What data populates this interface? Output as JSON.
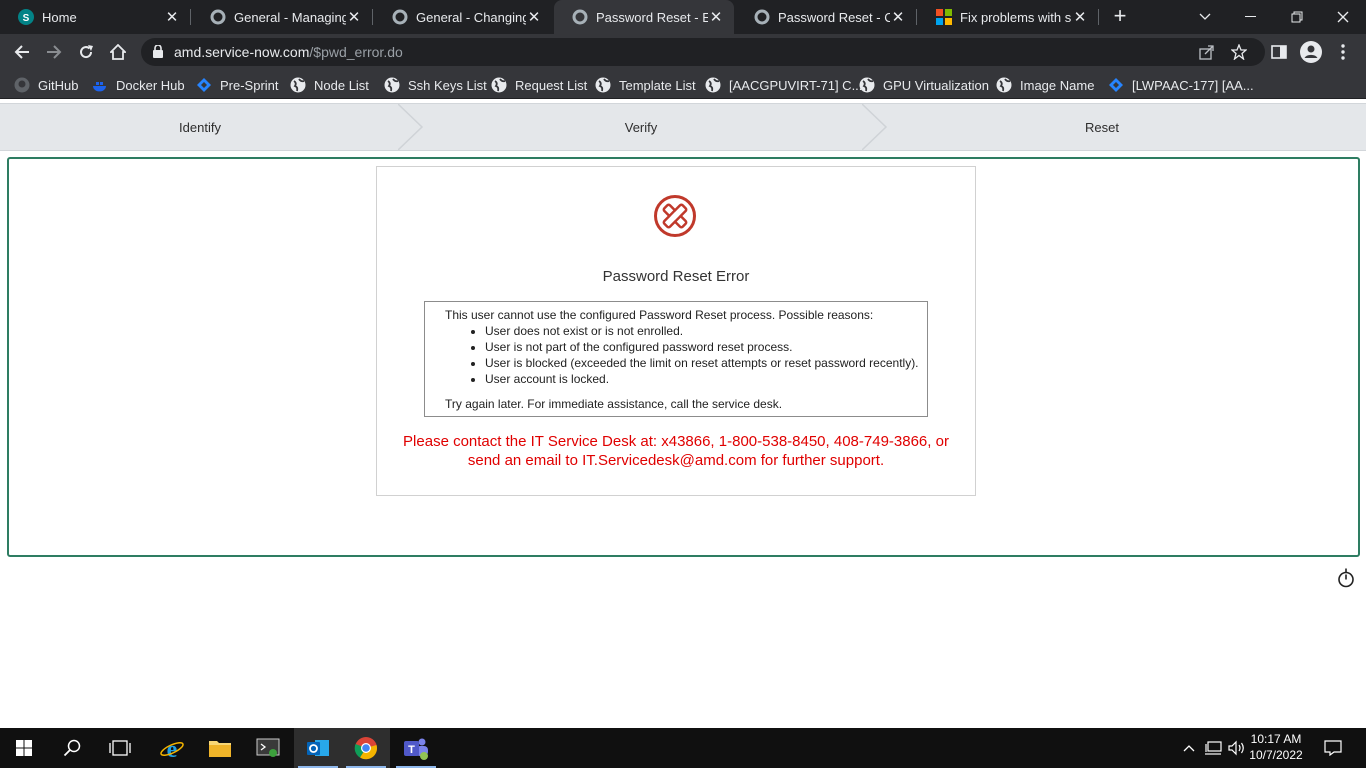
{
  "tabs": [
    {
      "title": "Home",
      "icon": "sharepoint-icon"
    },
    {
      "title": "General - Managing Yo",
      "icon": "servicenow-icon"
    },
    {
      "title": "General - Changing Yo",
      "icon": "servicenow-icon"
    },
    {
      "title": "Password Reset - Error",
      "icon": "servicenow-icon"
    },
    {
      "title": "Password Reset - Chan",
      "icon": "servicenow-icon"
    },
    {
      "title": "Fix problems with shar",
      "icon": "microsoft-icon"
    }
  ],
  "address": {
    "host": "amd.service-now.com",
    "path": "/$pwd_error.do"
  },
  "bookmarks": [
    {
      "label": "GitHub",
      "icon": "github-icon"
    },
    {
      "label": "Docker Hub",
      "icon": "docker-icon"
    },
    {
      "label": "Pre-Sprint",
      "icon": "jira-icon"
    },
    {
      "label": "Node List",
      "icon": "globe-icon"
    },
    {
      "label": "Ssh Keys List",
      "icon": "globe-icon"
    },
    {
      "label": "Request List",
      "icon": "globe-icon"
    },
    {
      "label": "Template List",
      "icon": "globe-icon"
    },
    {
      "label": "[AACGPUVIRT-71] C...",
      "icon": "globe-icon"
    },
    {
      "label": "GPU Virtualization",
      "icon": "globe-icon"
    },
    {
      "label": "Image Name",
      "icon": "globe-icon"
    },
    {
      "label": "[LWPAAC-177] [AA...",
      "icon": "jira-icon"
    }
  ],
  "steps": [
    "Identify",
    "Verify",
    "Reset"
  ],
  "error": {
    "title": "Password Reset Error",
    "intro": "This user cannot use the configured Password Reset process. Possible reasons:",
    "reasons": [
      "User does not exist or is not enrolled.",
      "User is not part of the configured password reset process.",
      "User is blocked (exceeded the limit on reset attempts or reset password recently).",
      "User account is locked."
    ],
    "try_again": "Try again later. For immediate assistance, call the service desk.",
    "contact_line1": "Please contact the IT Service Desk at: x43866, 1-800-538-8450, 408-749-3866, or",
    "contact_line2": "send an email to IT.Servicedesk@amd.com for further support."
  },
  "clock": {
    "time": "10:17 AM",
    "date": "10/7/2022"
  },
  "colors": {
    "accent_green": "#2e7d62",
    "error_red": "#e00000",
    "icon_red": "#c0392b"
  }
}
